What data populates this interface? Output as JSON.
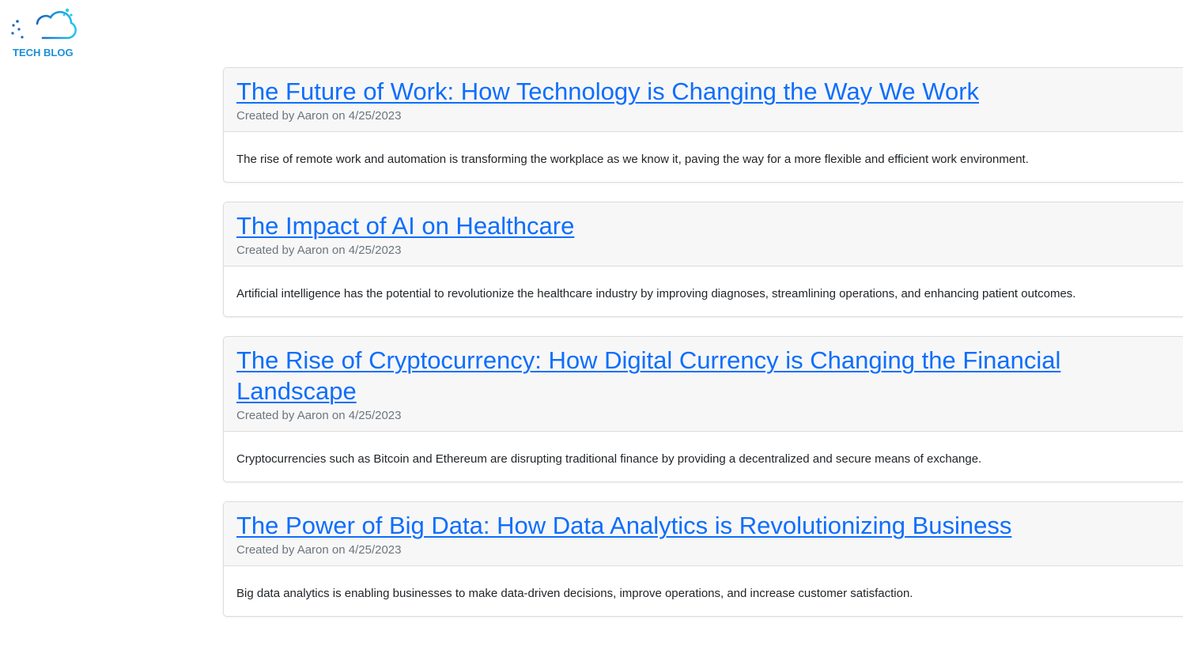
{
  "brand": {
    "logo_text": "TECH BLOG",
    "logo_icon": "cloud-circuit-icon",
    "accent_color": "#1a8fd8"
  },
  "posts": [
    {
      "title": "The Future of Work: How Technology is Changing the Way We Work",
      "meta": "Created by Aaron on 4/25/2023",
      "excerpt": "The rise of remote work and automation is transforming the workplace as we know it, paving the way for a more flexible and efficient work environment."
    },
    {
      "title": "The Impact of AI on Healthcare",
      "meta": "Created by Aaron on 4/25/2023",
      "excerpt": "Artificial intelligence has the potential to revolutionize the healthcare industry by improving diagnoses, streamlining operations, and enhancing patient outcomes."
    },
    {
      "title": "The Rise of Cryptocurrency: How Digital Currency is Changing the Financial Landscape",
      "meta": "Created by Aaron on 4/25/2023",
      "excerpt": "Cryptocurrencies such as Bitcoin and Ethereum are disrupting traditional finance by providing a decentralized and secure means of exchange."
    },
    {
      "title": "The Power of Big Data: How Data Analytics is Revolutionizing Business",
      "meta": "Created by Aaron on 4/25/2023",
      "excerpt": "Big data analytics is enabling businesses to make data-driven decisions, improve operations, and increase customer satisfaction."
    }
  ],
  "colors": {
    "link": "#0d6efd",
    "muted": "#6c757d",
    "header_bg": "#f7f7f7"
  }
}
